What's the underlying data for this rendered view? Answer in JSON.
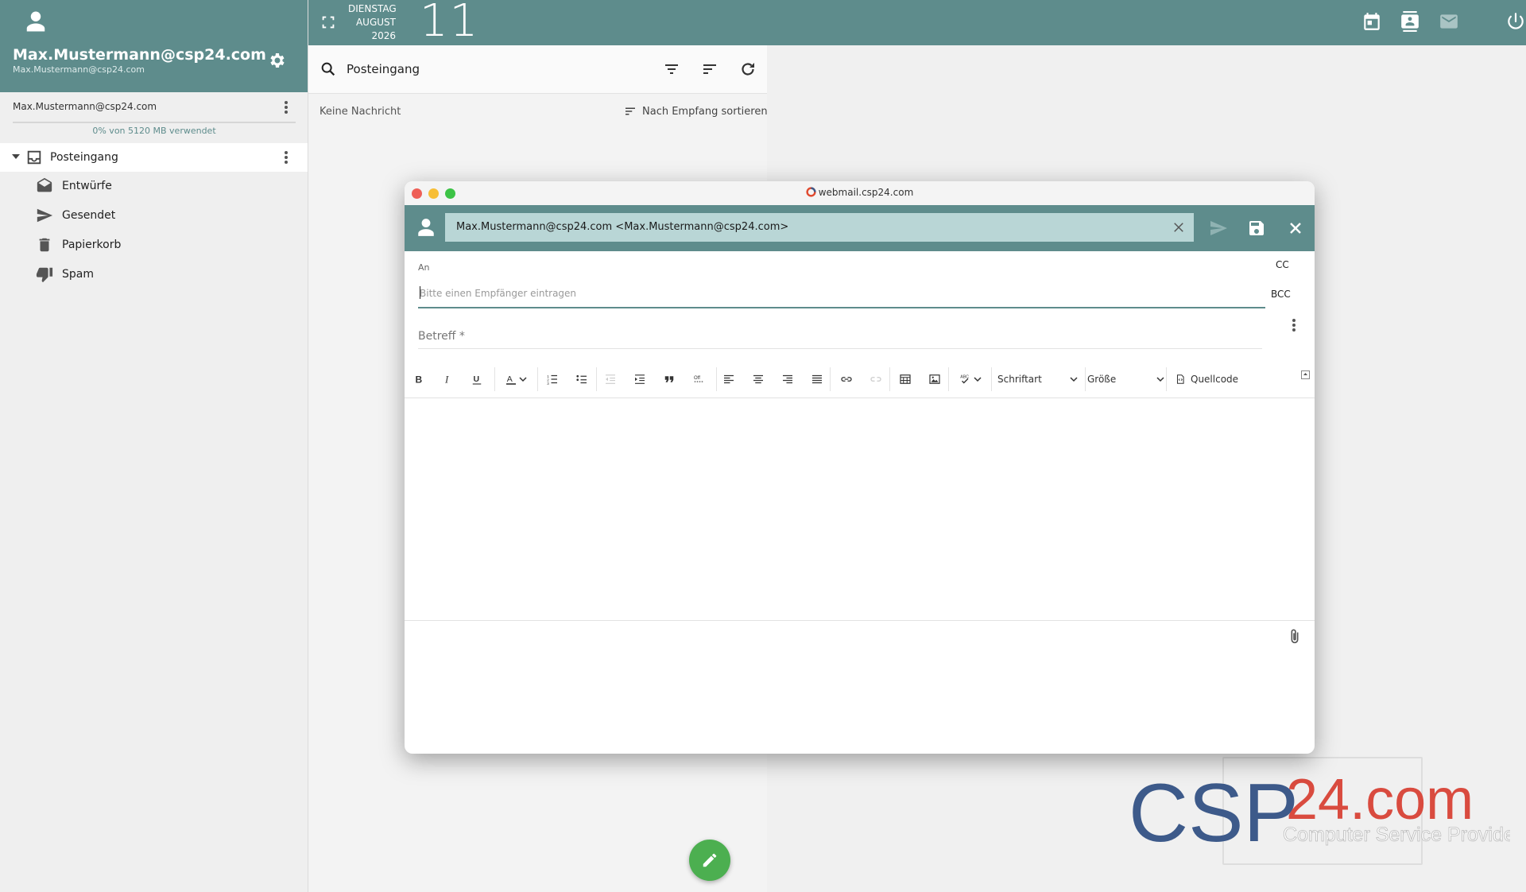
{
  "account": {
    "display_name": "Max.Mustermann@csp24.com",
    "sub_email": "Max.Mustermann@csp24.com",
    "row_email": "Max.Mustermann@csp24.com",
    "quota_text": "0% von 5120 MB verwendet"
  },
  "folders": [
    {
      "label": "Posteingang",
      "icon": "inbox-icon"
    },
    {
      "label": "Entwürfe",
      "icon": "drafts-icon"
    },
    {
      "label": "Gesendet",
      "icon": "send-icon"
    },
    {
      "label": "Papierkorb",
      "icon": "trash-icon"
    },
    {
      "label": "Spam",
      "icon": "thumbs-down-icon"
    }
  ],
  "date": {
    "weekday": "DIENSTAG",
    "month": "AUGUST",
    "year": "2026",
    "day": "11"
  },
  "message_list": {
    "search_label": "Posteingang",
    "empty_text": "Keine Nachricht",
    "sort_label": "Nach Empfang sortieren"
  },
  "compose": {
    "window_title": "webmail.csp24.com",
    "from": "Max.Mustermann@csp24.com <Max.Mustermann@csp24.com>",
    "to_label": "An",
    "to_placeholder": "Bitte einen Empfänger eintragen",
    "cc_label": "CC",
    "bcc_label": "BCC",
    "subject_placeholder": "Betreff *",
    "font_select": "Schriftart",
    "size_select": "Größe",
    "source_label": "Quellcode"
  },
  "logo": {
    "text_main": "CSP",
    "text_accent": "24.com",
    "tagline": "Computer Service Provider"
  },
  "colors": {
    "accent": "#5e8c8c",
    "accent_light": "#b9d6d6",
    "fab": "#4caf50",
    "logo_blue": "#3d5a8a",
    "logo_red": "#d94b3f"
  }
}
